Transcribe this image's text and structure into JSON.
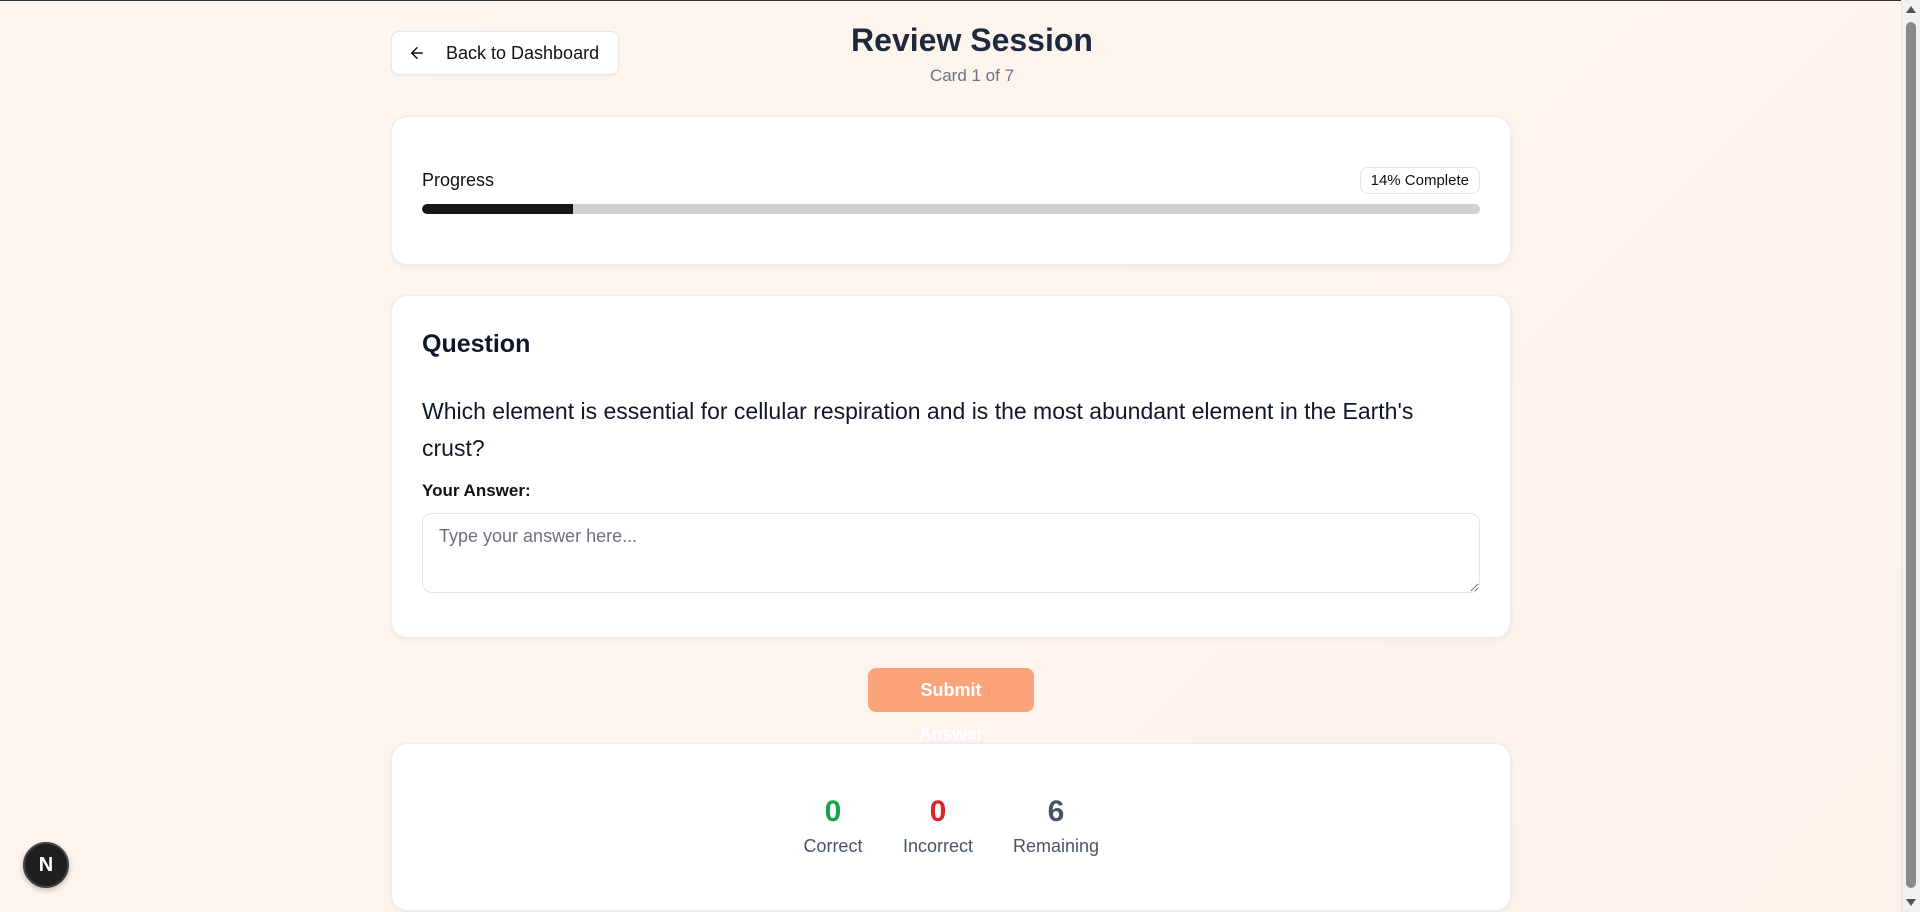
{
  "header": {
    "back_label": "Back to Dashboard",
    "title": "Review Session",
    "subtitle": "Card 1 of 7"
  },
  "progress": {
    "label": "Progress",
    "badge": "14% Complete",
    "fraction": 0.143
  },
  "question": {
    "heading": "Question",
    "text": "Which element is essential for cellular respiration and is the most abundant element in the Earth's crust?",
    "answer_label": "Your Answer:",
    "answer_placeholder": "Type your answer here...",
    "answer_value": ""
  },
  "submit": {
    "label": "Submit Answer"
  },
  "stats": [
    {
      "value": "0",
      "label": "Correct",
      "color": "#16a34a"
    },
    {
      "value": "0",
      "label": "Incorrect",
      "color": "#dc2626"
    },
    {
      "value": "6",
      "label": "Remaining",
      "color": "#475569"
    }
  ],
  "colors": {
    "accent_button": "#fba47c",
    "progress_fill": "#171717"
  },
  "icons": {
    "back": "arrow-left-icon",
    "framework": "nextjs-logo-icon"
  },
  "framework_badge": {
    "letter": "N"
  }
}
